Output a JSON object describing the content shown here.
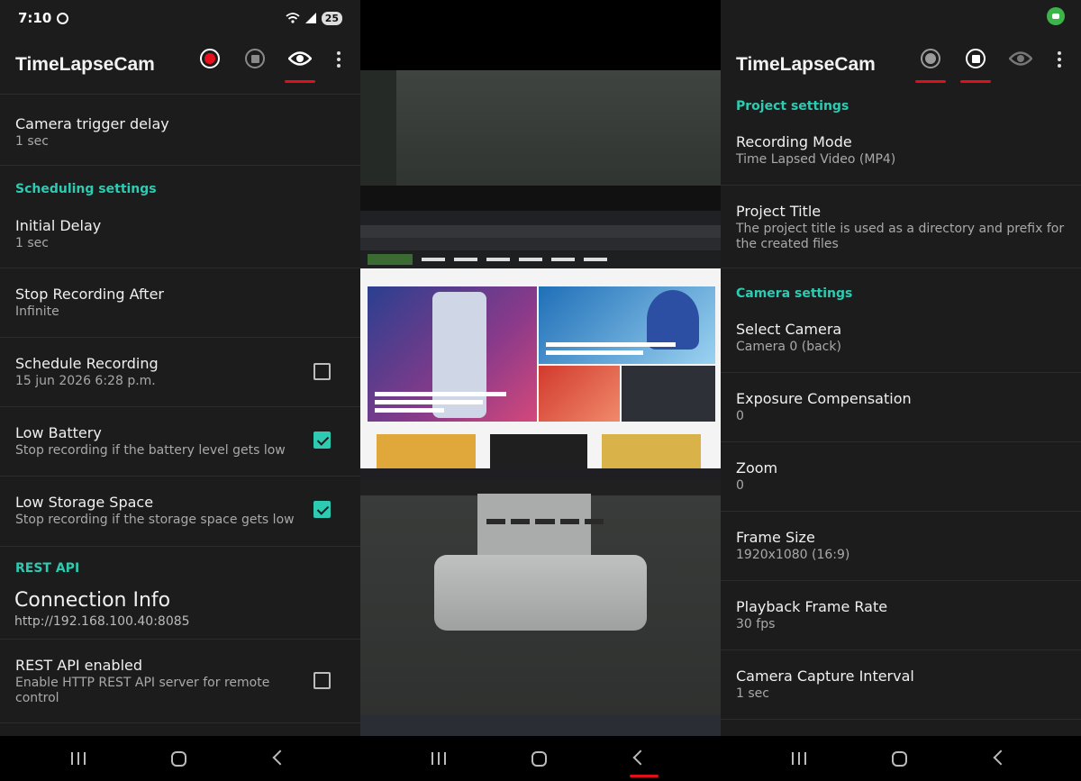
{
  "left": {
    "status": {
      "time": "7:10",
      "battery": "25"
    },
    "app_title": "TimeLapseCam",
    "items": [
      {
        "title": "Camera trigger delay",
        "summary": "1 sec"
      },
      {
        "title": "Initial Delay",
        "summary": "1 sec"
      },
      {
        "title": "Stop Recording After",
        "summary": "Infinite"
      },
      {
        "title": "Schedule Recording",
        "summary": "15 jun 2026 6:28 p.m.",
        "checked": false
      },
      {
        "title": "Low Battery",
        "summary": "Stop recording if the battery level gets low",
        "checked": true
      },
      {
        "title": "Low Storage Space",
        "summary": "Stop recording if the storage space gets low",
        "checked": true
      },
      {
        "title": "Connection Info",
        "summary": "http://192.168.100.40:8085"
      },
      {
        "title": "REST API enabled",
        "summary": "Enable HTTP REST API server for remote control",
        "checked": false
      }
    ],
    "sections": {
      "scheduling": "Scheduling settings",
      "rest_api": "REST API"
    }
  },
  "right": {
    "app_title": "TimeLapseCam",
    "sections": {
      "project": "Project settings",
      "camera": "Camera settings"
    },
    "items": [
      {
        "title": "Recording Mode",
        "summary": "Time Lapsed Video (MP4)"
      },
      {
        "title": "Project Title",
        "summary": "The project title is used as a directory and prefix for the created files"
      },
      {
        "title": "Select Camera",
        "summary": "Camera 0 (back)"
      },
      {
        "title": "Exposure Compensation",
        "summary": "0"
      },
      {
        "title": "Zoom",
        "summary": "0"
      },
      {
        "title": "Frame Size",
        "summary": "1920x1080 (16:9)"
      },
      {
        "title": "Playback Frame Rate",
        "summary": "30 fps"
      },
      {
        "title": "Camera Capture Interval",
        "summary": "1 sec"
      }
    ]
  },
  "colors": {
    "accent": "#2ccbb2",
    "record": "#e8101c",
    "underline": "#e0101a",
    "background": "#1c1c1c"
  },
  "icons": [
    "whatsapp-icon",
    "wifi-icon",
    "signal-icon",
    "battery-icon",
    "record-icon",
    "stop-icon",
    "preview-eye-icon",
    "more-vert-icon",
    "recents-icon",
    "home-icon",
    "back-icon",
    "camera-indicator-icon"
  ]
}
